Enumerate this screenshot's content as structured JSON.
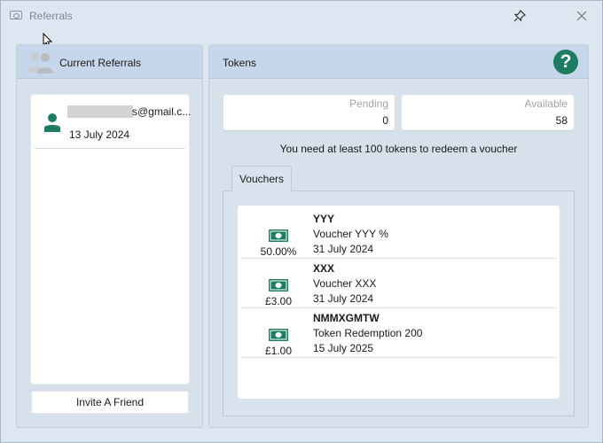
{
  "window": {
    "title": "Referrals"
  },
  "colors": {
    "accent": "#1e7c62",
    "header_bg": "#c6d7ec",
    "panel_bg": "#d6e1ec"
  },
  "icons": {
    "title": "referral-card-icon",
    "pin": "pin-icon",
    "close": "close-icon",
    "referrals_header": "people-icon",
    "help": "question-mark-icon",
    "referral_avatar": "person-icon",
    "voucher": "banknote-icon"
  },
  "referrals": {
    "title": "Current Referrals",
    "items": [
      {
        "email": "s@gmail.c...",
        "date": "13 July 2024"
      }
    ],
    "invite_label": "Invite A Friend"
  },
  "tokens": {
    "title": "Tokens",
    "help_label": "?",
    "pending_label": "Pending",
    "pending_value": "0",
    "available_label": "Available",
    "available_value": "58",
    "notice": "You need at least 100 tokens to redeem a voucher"
  },
  "tabs": [
    {
      "label": "Vouchers",
      "active": true
    }
  ],
  "vouchers": [
    {
      "value": "50.00%",
      "code": "YYY",
      "description": "Voucher YYY %",
      "date": "31 July 2024"
    },
    {
      "value": "£3.00",
      "code": "XXX",
      "description": "Voucher XXX",
      "date": "31 July 2024"
    },
    {
      "value": "£1.00",
      "code": "NMMXGMTW",
      "description": "Token Redemption 200",
      "date": "15 July 2025"
    }
  ]
}
